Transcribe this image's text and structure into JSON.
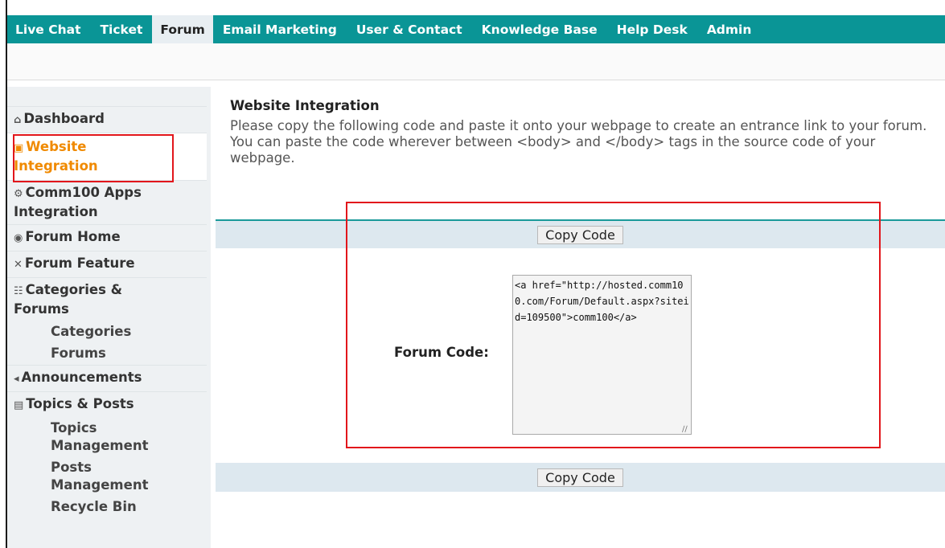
{
  "topnav": {
    "items": [
      {
        "label": "Live Chat"
      },
      {
        "label": "Ticket"
      },
      {
        "label": "Forum"
      },
      {
        "label": "Email Marketing"
      },
      {
        "label": "User & Contact"
      },
      {
        "label": "Knowledge Base"
      },
      {
        "label": "Help Desk"
      },
      {
        "label": "Admin"
      }
    ],
    "active": "Forum"
  },
  "sidebar": {
    "items": [
      {
        "icon": "home-icon",
        "glyph": "⌂",
        "label": "Dashboard"
      },
      {
        "icon": "cart-icon",
        "glyph": "🛒",
        "label": "Website",
        "label2": "Integration"
      },
      {
        "icon": "apps-icon",
        "glyph": "⚙",
        "label": "Comm100 Apps",
        "label2": "Integration"
      },
      {
        "icon": "globe-icon",
        "glyph": "◉",
        "label": "Forum Home"
      },
      {
        "icon": "tools-icon",
        "glyph": "✕",
        "label": "Forum Feature"
      },
      {
        "icon": "hierarchy-icon",
        "glyph": "品",
        "label": "Categories &",
        "label2": "Forums"
      },
      {
        "icon": "speaker-icon",
        "glyph": "◂",
        "label": "Announcements"
      },
      {
        "icon": "posts-icon",
        "glyph": "▤",
        "label": "Topics & Posts"
      }
    ],
    "sub_categories": [
      "Categories",
      "Forums"
    ],
    "sub_topics": [
      {
        "label": "Topics",
        "label2": "Management"
      },
      {
        "label": "Posts",
        "label2": "Management"
      },
      {
        "label": "Recycle Bin"
      }
    ]
  },
  "main": {
    "title": "Website Integration",
    "description": "Please copy the following code and paste it onto your webpage to create an entrance link to your forum. You can paste the code wherever between <body> and </body> tags in the source code of your webpage.",
    "copy_button": "Copy Code",
    "forum_code_label": "Forum Code:",
    "forum_code_value": "<a href=\"http://hosted.comm100.com/Forum/Default.aspx?siteid=109500\">comm100</a>"
  },
  "colors": {
    "nav_bg": "#0a9596",
    "active_orange": "#f08a00",
    "highlight_red": "#e2161b",
    "band_bg": "#dde8ef"
  }
}
